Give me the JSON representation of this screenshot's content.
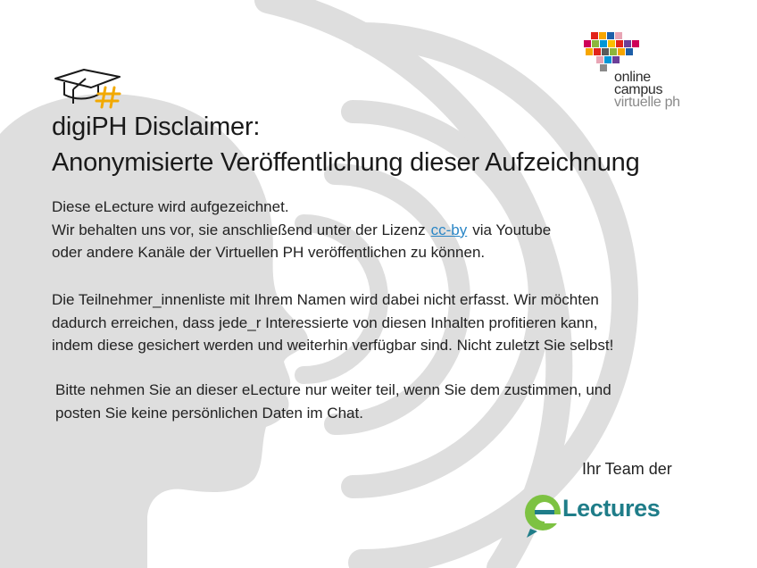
{
  "background": {
    "icon": "speaking-head-silhouette-icon",
    "color": "#dedede"
  },
  "header": {
    "title_line_1": "digiPH Disclaimer:",
    "title_line_2": "Anonymisierte Veröffentlichung dieser Aufzeichnung",
    "icon": "graduation-cap-hash-icon",
    "icon_colors": {
      "cap": "#1a1a1a",
      "hash": "#f2a900"
    }
  },
  "logo_onlinecampus": {
    "line_1": "online",
    "line_2": "campus",
    "line_3": "virtuelle ph",
    "mosaic_colors": [
      "#e2231a",
      "#f7a600",
      "#1d5fa8",
      "#8cb63c",
      "#6c3f98",
      "#e8a5b5",
      "#ce0058",
      "#0096d6",
      "#5a5a5a",
      "#fbbf00"
    ]
  },
  "body": {
    "p1_line_1": "Diese eLecture wird aufgezeichnet.",
    "p1_line_2_before": "Wir behalten uns vor, sie anschließend unter der Lizenz",
    "p1_link": "cc-by",
    "p1_line_2_after": "via Youtube",
    "p1_line_3": "oder andere Kanäle der Virtuellen PH veröffentlichen zu können.",
    "p2_line_1": "Die Teilnehmer_innenliste mit Ihrem Namen wird dabei nicht erfasst. Wir möchten",
    "p2_line_2": "dadurch erreichen, dass jede_r Interessierte von diesen Inhalten profitieren kann,",
    "p2_line_3": "indem diese gesichert werden und weiterhin verfügbar sind. Nicht zuletzt Sie selbst!",
    "p3_line_1": "Bitte nehmen Sie an dieser eLecture nur weiter teil, wenn Sie dem zustimmen, und",
    "p3_line_2": "posten Sie keine persönlichen Daten im Chat."
  },
  "footer": {
    "signoff": "Ihr Team der",
    "brand": "Lectures",
    "brand_colors": {
      "green": "#7dc242",
      "teal": "#1f7d89"
    }
  },
  "colors": {
    "link": "#2a86c6",
    "text": "#222222"
  }
}
